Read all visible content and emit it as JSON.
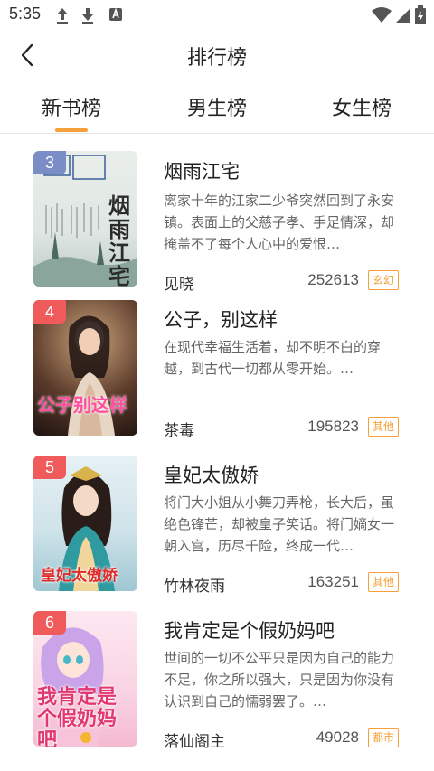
{
  "status_bar": {
    "time": "5:35"
  },
  "header": {
    "title": "排行榜",
    "back_icon": "chevron-left-icon"
  },
  "tabs": [
    {
      "label": "新书榜",
      "active": true
    },
    {
      "label": "男生榜",
      "active": false
    },
    {
      "label": "女生榜",
      "active": false
    }
  ],
  "colors": {
    "accent": "#f5a03a",
    "rank_blue": "#7b8dc6",
    "rank_red": "#ef5a5a"
  },
  "books": [
    {
      "rank": "3",
      "title": "烟雨江宅",
      "description": "离家十年的江家二少爷突然回到了永安镇。表面上的父慈子孝、手足情深，却掩盖不了每个人心中的爱恨…",
      "author": "见晓",
      "count": "252613",
      "tag": "玄幻",
      "cover_text": "烟雨江宅"
    },
    {
      "rank": "4",
      "title": "公子，别这样",
      "description": "在现代幸福生活着，却不明不白的穿越，到古代一切都从零开始。…",
      "author": "茶毒",
      "count": "195823",
      "tag": "其他",
      "cover_text": "公子别这样"
    },
    {
      "rank": "5",
      "title": "皇妃太傲娇",
      "description": "将门大小姐从小舞刀弄枪，长大后，虽绝色锋芒，却被皇子笑话。将门嫡女一朝入宫，历尽千险，终成一代…",
      "author": "竹林夜雨",
      "count": "163251",
      "tag": "其他",
      "cover_text": "皇妃太傲娇"
    },
    {
      "rank": "6",
      "title": "我肯定是个假奶妈吧",
      "description": "世间的一切不公平只是因为自己的能力不足，你之所以强大，只是因为你没有认识到自己的懦弱罢了。…",
      "author": "落仙阁主",
      "count": "49028",
      "tag": "都市",
      "cover_text": "我肯定是个假奶妈吧"
    }
  ]
}
